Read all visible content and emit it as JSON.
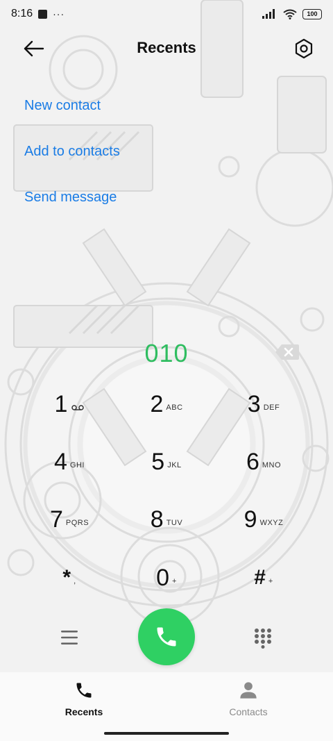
{
  "status_bar": {
    "time": "8:16",
    "notification_dots": "···",
    "battery": "100"
  },
  "header": {
    "title": "Recents",
    "back_icon": "arrow-left-icon",
    "settings_icon": "hexagon-gear-icon"
  },
  "actions": [
    {
      "label": "New contact"
    },
    {
      "label": "Add to contacts"
    },
    {
      "label": "Send message"
    }
  ],
  "dialer": {
    "number": "010",
    "accent_color": "#2fbd60",
    "keys": [
      {
        "digit": "1",
        "letters": "voicemail-icon"
      },
      {
        "digit": "2",
        "letters": "ABC"
      },
      {
        "digit": "3",
        "letters": "DEF"
      },
      {
        "digit": "4",
        "letters": "GHI"
      },
      {
        "digit": "5",
        "letters": "JKL"
      },
      {
        "digit": "6",
        "letters": "MNO"
      },
      {
        "digit": "7",
        "letters": "PQRS"
      },
      {
        "digit": "8",
        "letters": "TUV"
      },
      {
        "digit": "9",
        "letters": "WXYZ"
      },
      {
        "digit": "*",
        "letters": ","
      },
      {
        "digit": "0",
        "letters": "+"
      },
      {
        "digit": "#",
        "letters": "+"
      }
    ]
  },
  "controls": {
    "menu_icon": "hamburger-icon",
    "call_icon": "phone-icon",
    "call_color": "#2fd063",
    "keypad_icon": "dialpad-icon"
  },
  "bottom_nav": {
    "items": [
      {
        "label": "Recents",
        "icon": "phone-icon",
        "active": true
      },
      {
        "label": "Contacts",
        "icon": "person-icon",
        "active": false
      }
    ]
  }
}
